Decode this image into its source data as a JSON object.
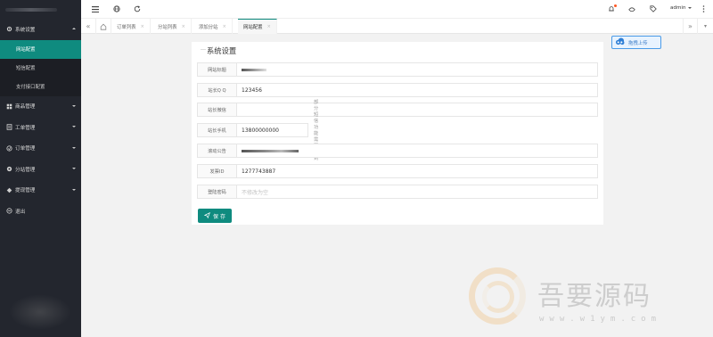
{
  "sidebar": {
    "menu": [
      {
        "label": "系统设置",
        "icon": "gear-icon",
        "expanded": true
      },
      {
        "label": "商品管理",
        "icon": "grid-icon"
      },
      {
        "label": "工单管理",
        "icon": "ticket-icon"
      },
      {
        "label": "订单管理",
        "icon": "cart-icon"
      },
      {
        "label": "分站管理",
        "icon": "site-icon"
      },
      {
        "label": "提现管理",
        "icon": "wallet-icon"
      },
      {
        "label": "退出",
        "icon": "logout-icon"
      }
    ],
    "submenu": [
      {
        "label": "网站配置",
        "active": true
      },
      {
        "label": "短信配置"
      },
      {
        "label": "支付接口配置"
      }
    ]
  },
  "topbar": {
    "user": "admin",
    "icons": [
      "menu-icon",
      "globe-icon",
      "refresh-icon",
      "bell-icon",
      "theme-icon",
      "tag-icon",
      "more-icon"
    ]
  },
  "tabs": [
    {
      "label": "订单列表"
    },
    {
      "label": "分站列表"
    },
    {
      "label": "添加分站"
    },
    {
      "label": "网站配置",
      "active": true
    }
  ],
  "upload_button": {
    "label": "拖拽上传"
  },
  "form": {
    "title": "系统设置",
    "fields": [
      {
        "label": "网站标题",
        "value": "",
        "placeholder": ""
      },
      {
        "label": "站长Q Q",
        "value": "123456",
        "placeholder": ""
      },
      {
        "label": "站长微信",
        "value": "",
        "placeholder": ""
      },
      {
        "label": "站长手机",
        "value": "13800000000",
        "placeholder": "",
        "hint": "部分短信功能需要用到"
      },
      {
        "label": "滚动公告",
        "value": "",
        "placeholder": ""
      },
      {
        "label": "发票ID",
        "value": "1277743887",
        "placeholder": ""
      },
      {
        "label": "登陆密码",
        "value": "",
        "placeholder": "不修改为空"
      }
    ],
    "save_label": "保 存"
  },
  "watermark": {
    "title": "吾要源码",
    "url": "www.w1ym.com"
  },
  "colors": {
    "accent": "#0f8b7f",
    "sidebar": "#23262e",
    "upload": "#4b9be8",
    "badge": "#ff5722"
  }
}
